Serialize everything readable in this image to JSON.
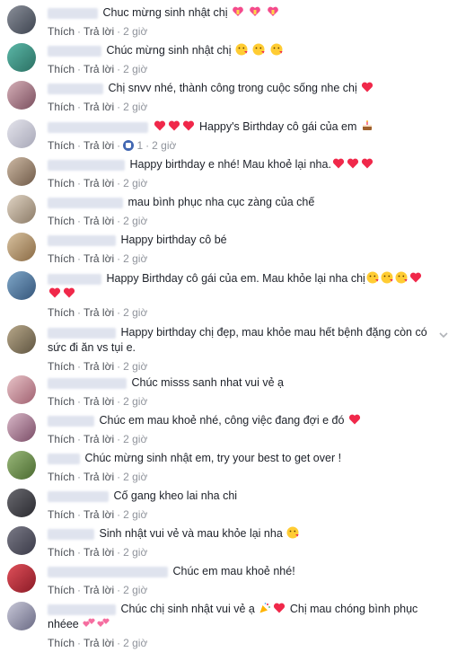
{
  "labels": {
    "like": "Thích",
    "reply": "Trả lời",
    "sep": "·"
  },
  "comments": [
    {
      "text": "Chuc mừng sinh nhật chị",
      "time": "2 giờ"
    },
    {
      "text": "Chúc mừng sinh nhật chị",
      "time": "2 giờ"
    },
    {
      "text": "Chị snvv nhé, thành công trong cuộc sống nhe chị",
      "time": "2 giờ"
    },
    {
      "text": "Happy's Birthday cô gái của em",
      "time": "2 giờ",
      "likes": "1"
    },
    {
      "text": "Happy birthday e nhé! Mau khoẻ lại nha.",
      "time": "2 giờ"
    },
    {
      "text": "mau bình phục nha cục zàng của chế",
      "time": "2 giờ"
    },
    {
      "text": "Happy birthday cô bé",
      "time": "2 giờ"
    },
    {
      "text": "Happy Birthday cô gái của em. Mau khỏe lại nha chị",
      "time": "2 giờ"
    },
    {
      "text": "Happy birthday chị đẹp, mau khỏe mau hết bệnh đặng còn có",
      "text2": "sức đi ăn vs tụi e.",
      "time": "2 giờ"
    },
    {
      "text": "Chúc misss sanh nhat vui vẻ ạ",
      "time": "2 giờ"
    },
    {
      "text": "Chúc em mau khoẻ nhé, công việc đang đợi e đó",
      "time": "2 giờ"
    },
    {
      "text": "Chúc mừng sinh nhật em, try your best to get over !",
      "time": "2 giờ"
    },
    {
      "text": "Cố gang kheo lai nha chi",
      "time": "2 giờ"
    },
    {
      "text": "Sinh nhật vui vẻ và mau khỏe lại nha",
      "time": "2 giờ"
    },
    {
      "text": "Chúc em mau khoẻ nhé!",
      "time": "2 giờ"
    },
    {
      "text": "Chúc chị sinh nhật vui vẻ ạ",
      "text2": "Chị mau chóng bình phục",
      "text3": "nhéee",
      "time": "2 giờ"
    }
  ],
  "colors": {
    "link": "#4b4f56",
    "meta": "#90949c",
    "heart": "#f0284a",
    "like": "#4267b2"
  }
}
